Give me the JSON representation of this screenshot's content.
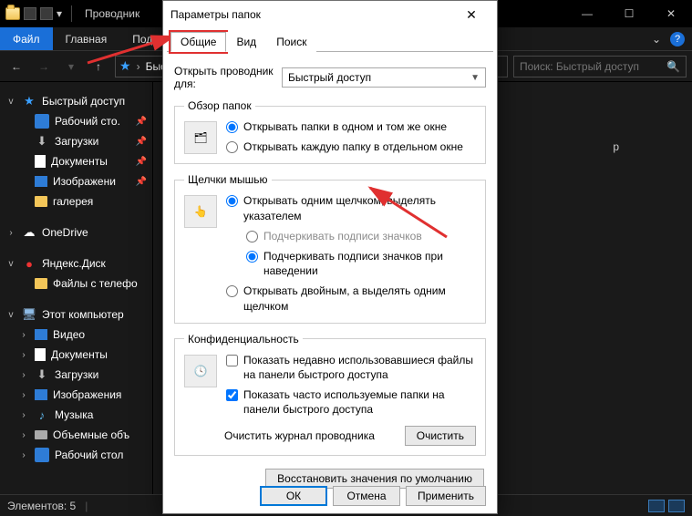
{
  "explorer": {
    "title": "Проводник",
    "tabs": {
      "file": "Файл",
      "home": "Главная",
      "share": "Подел"
    },
    "address_label": "Быстр",
    "search_placeholder": "Поиск: Быстрый доступ",
    "status": "Элементов: 5",
    "content_hint": "р",
    "sidebar": {
      "quick": "Быстрый доступ",
      "desktop": "Рабочий сто.",
      "downloads": "Загрузки",
      "documents": "Документы",
      "pictures": "Изображени",
      "gallery": "галерея",
      "onedrive": "OneDrive",
      "yadisk": "Яндекс.Диск",
      "yafiles": "Файлы с телефо",
      "thispc": "Этот компьютер",
      "video": "Видео",
      "documents2": "Документы",
      "downloads2": "Загрузки",
      "pictures2": "Изображения",
      "music": "Музыка",
      "volumes": "Объемные объ",
      "desktop2": "Рабочий стол"
    }
  },
  "dialog": {
    "title": "Параметры папок",
    "tabs": {
      "general": "Общие",
      "view": "Вид",
      "search": "Поиск"
    },
    "open_label": "Открыть проводник для:",
    "open_value": "Быстрый доступ",
    "browse": {
      "legend": "Обзор папок",
      "same": "Открывать папки в одном и том же окне",
      "new": "Открывать каждую папку в отдельном окне"
    },
    "click": {
      "legend": "Щелчки мышью",
      "single": "Открывать одним щелчком, выделять указателем",
      "underline_always": "Подчеркивать подписи значков",
      "underline_hover": "Подчеркивать подписи значков при наведении",
      "double": "Открывать двойным, а выделять одним щелчком"
    },
    "privacy": {
      "legend": "Конфиденциальность",
      "recent": "Показать недавно использовавшиеся файлы на панели быстрого доступа",
      "freq": "Показать часто используемые папки на панели быстрого доступа",
      "clear_label": "Очистить журнал проводника",
      "clear_btn": "Очистить"
    },
    "restore": "Восстановить значения по умолчанию",
    "ok": "ОК",
    "cancel": "Отмена",
    "apply": "Применить"
  }
}
